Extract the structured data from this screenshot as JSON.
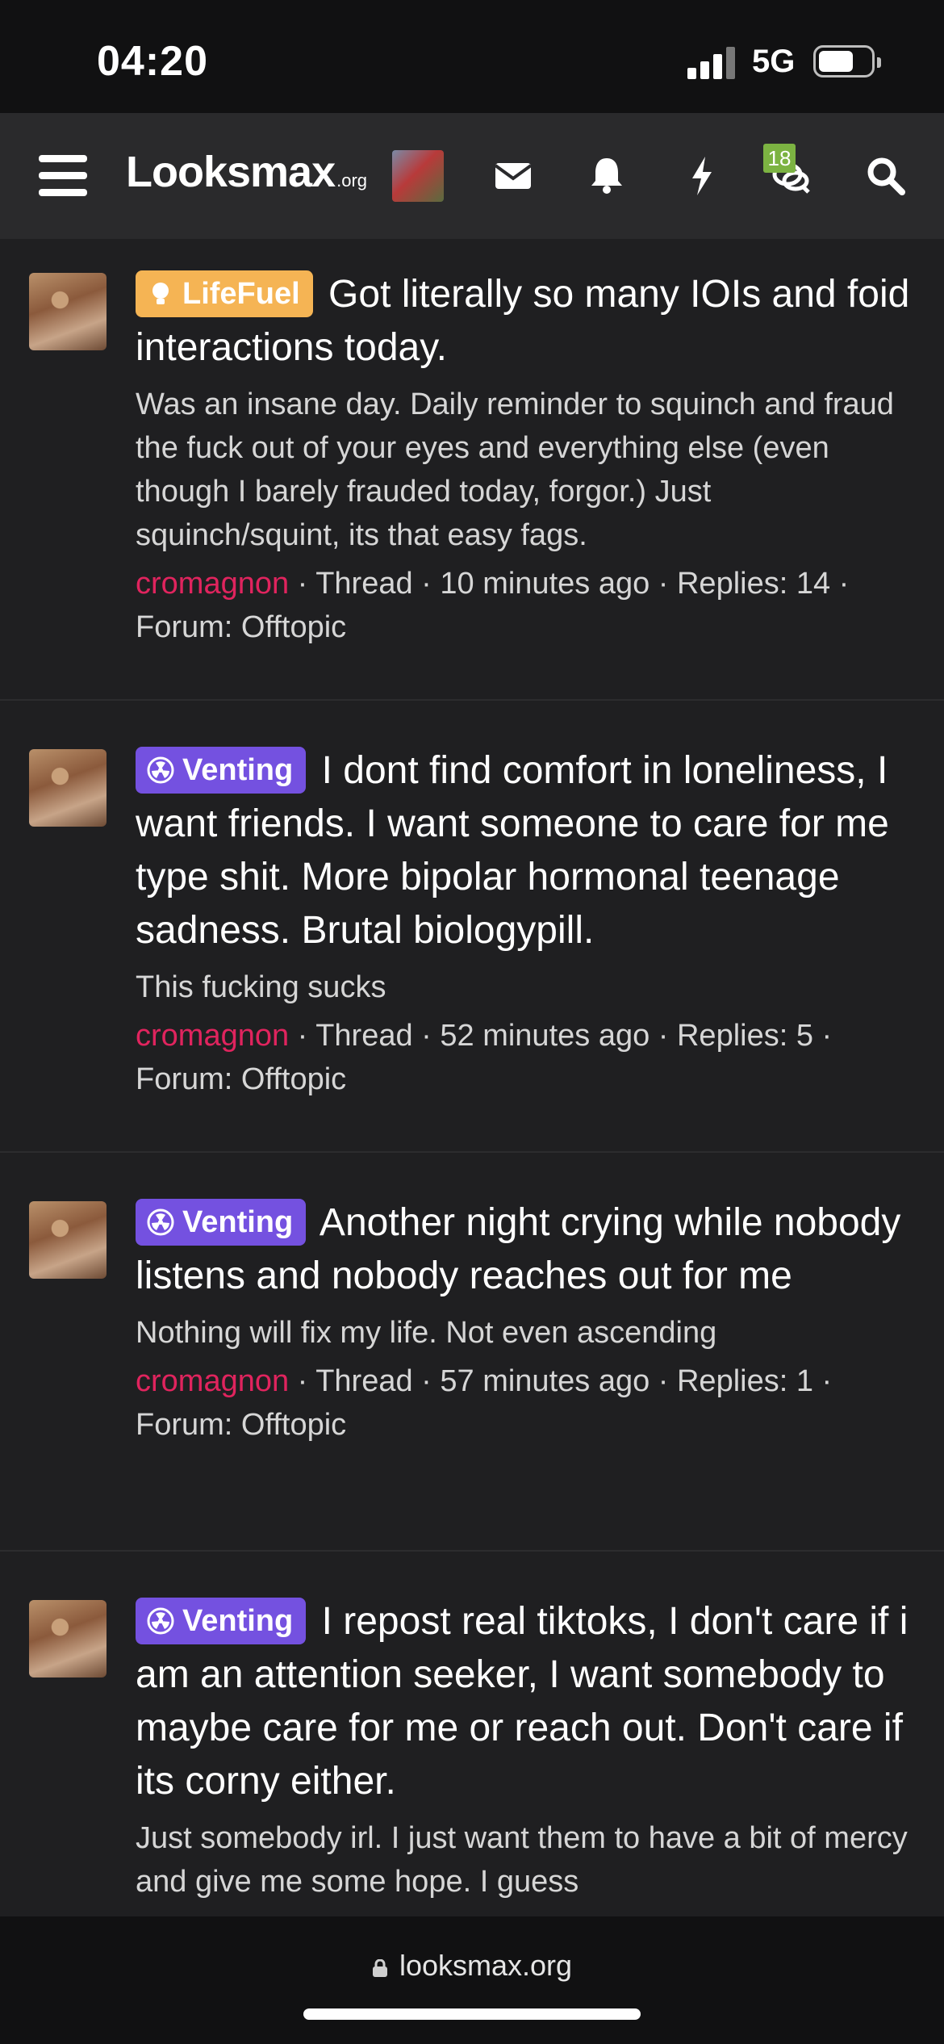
{
  "status_bar": {
    "time": "04:20",
    "network": "5G",
    "icons": [
      "signal-icon",
      "battery-icon"
    ]
  },
  "header": {
    "logo_main": "Looksmax",
    "logo_suffix": ".org",
    "notification_badge": "18",
    "icons": [
      "menu-icon",
      "avatar",
      "mail-icon",
      "bell-icon",
      "bolt-icon",
      "chat-icon",
      "search-icon"
    ]
  },
  "threads": [
    {
      "prefix": "LifeFuel",
      "prefix_style": "lifefuel",
      "prefix_icon": "lightbulb-icon",
      "title": "Got literally so many IOIs and foid interactions today.",
      "snippet": "Was an insane day. Daily reminder to squinch and fraud the fuck out of your eyes and everything else (even though I barely frauded today, forgor.) Just squinch/squint, its that easy fags.",
      "author": "cromagnon",
      "meta_rest": " · Thread · 10 minutes ago · Replies: 14 · Forum: Offtopic"
    },
    {
      "prefix": "Venting",
      "prefix_style": "venting",
      "prefix_icon": "radiation-icon",
      "title": "I dont find comfort in loneliness, I want friends. I want someone to care for me type shit. More bipolar hormonal teenage sadness. Brutal biologypill.",
      "snippet": "This fucking sucks",
      "author": "cromagnon",
      "meta_rest": " · Thread · 52 minutes ago · Replies: 5 · Forum: Offtopic"
    },
    {
      "prefix": "Venting",
      "prefix_style": "venting",
      "prefix_icon": "radiation-icon",
      "title": "Another night crying while nobody listens and nobody reaches out for me",
      "snippet": "Nothing will fix my life. Not even ascending",
      "author": "cromagnon",
      "meta_rest": " · Thread · 57 minutes ago · Replies: 1 · Forum: Offtopic"
    },
    {
      "prefix": "Venting",
      "prefix_style": "venting",
      "prefix_icon": "radiation-icon",
      "title": "I repost real tiktoks, I don't care if i am an attention seeker, I want somebody to maybe care for me or reach out. Don't care if its corny either.",
      "snippet": "Just somebody irl. I just want them to have a bit of mercy and give me some hope. I guess",
      "author": "",
      "meta_rest": ""
    }
  ],
  "url_bar": {
    "url": "looksmax.org"
  },
  "colors": {
    "background": "#1f1f21",
    "header": "#2a2a2c",
    "lifefuel": "#f5b454",
    "venting": "#7451e0",
    "author": "#e0245e",
    "badge": "#7cb342"
  }
}
